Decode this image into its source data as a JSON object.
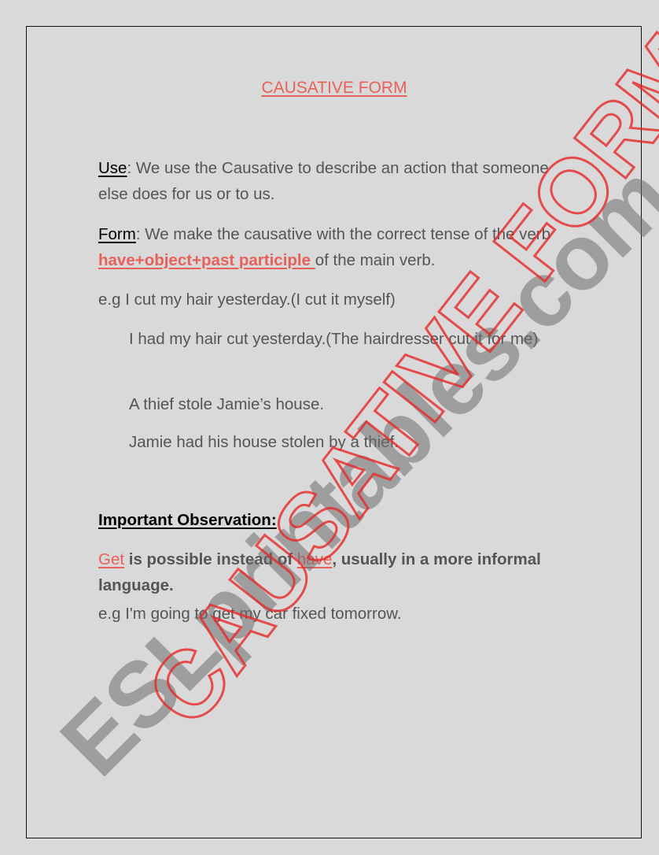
{
  "title": "CAUSATIVE FORM",
  "use": {
    "label": "Use",
    "colon": ":",
    "text": " We use the Causative to describe an action that someone else does for us or to us."
  },
  "form": {
    "label": "Form",
    "colon": ": ",
    "text_before": "We make the causative with the correct tense of the verb ",
    "highlight": "have+object+past participle ",
    "text_after": "of the main verb."
  },
  "examples": [
    "e.g I cut my hair yesterday.(I cut it myself)",
    "I had my hair cut yesterday.(The hairdresser cut it for me)",
    "A thief stole Jamie’s house.",
    "Jamie had his house stolen by a thief."
  ],
  "observation": {
    "heading": "Important Observation:",
    "get": "Get",
    "middle": " is possible instead of ",
    "have": "have",
    "rest": ", usually in a more informal language.",
    "example": "e.g I'm going to get my car fixed tomorrow."
  },
  "watermark": {
    "gray": "ESLprintables.com",
    "red": "CAUSATIVE FORM"
  },
  "colors": {
    "accent_red": "#e8605a",
    "body_text": "#555555",
    "background": "#d9d9d9"
  }
}
